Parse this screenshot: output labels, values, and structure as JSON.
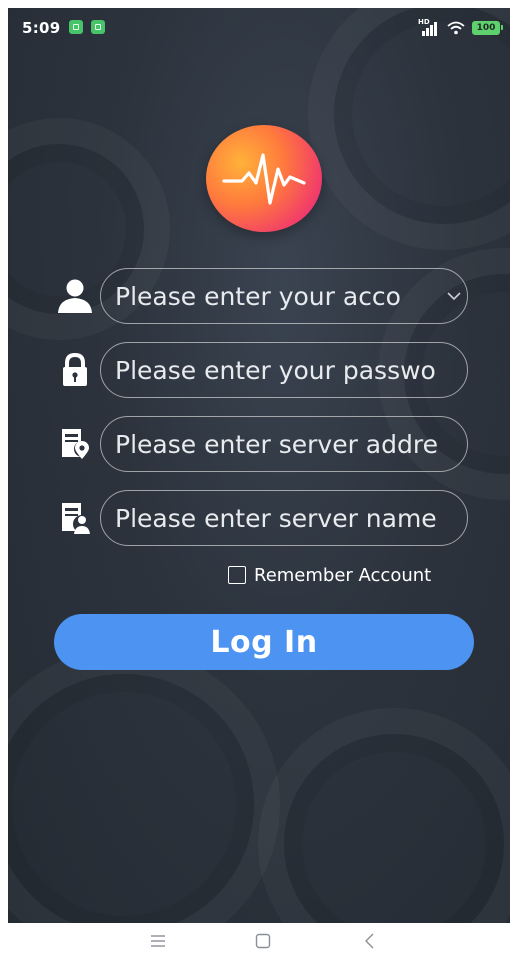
{
  "status_bar": {
    "time": "5:09",
    "battery_level": "100",
    "network_label": "HD",
    "notifications": [
      "app-notification-icon",
      "app-notification-icon"
    ]
  },
  "logo": {
    "icon": "heartbeat-pulse-icon",
    "colors": [
      "#ffb23a",
      "#ff7a3d",
      "#f0366e"
    ]
  },
  "form": {
    "account": {
      "icon": "user-icon",
      "placeholder": "Please enter your acco",
      "has_dropdown": true
    },
    "password": {
      "icon": "lock-icon",
      "placeholder": "Please enter your passwo"
    },
    "server_address": {
      "icon": "server-location-icon",
      "placeholder": "Please enter server addre"
    },
    "server_name": {
      "icon": "server-user-icon",
      "placeholder": "Please enter server name"
    },
    "remember_label": "Remember Account",
    "remember_checked": false,
    "login_label": "Log In"
  },
  "nav_bar": {
    "items": [
      "menu-icon",
      "home-square-icon",
      "back-chevron-icon"
    ]
  },
  "colors": {
    "background": "#2c333d",
    "login_button": "#4c93f2",
    "battery": "#5fd06e",
    "notification": "#47c36a"
  }
}
